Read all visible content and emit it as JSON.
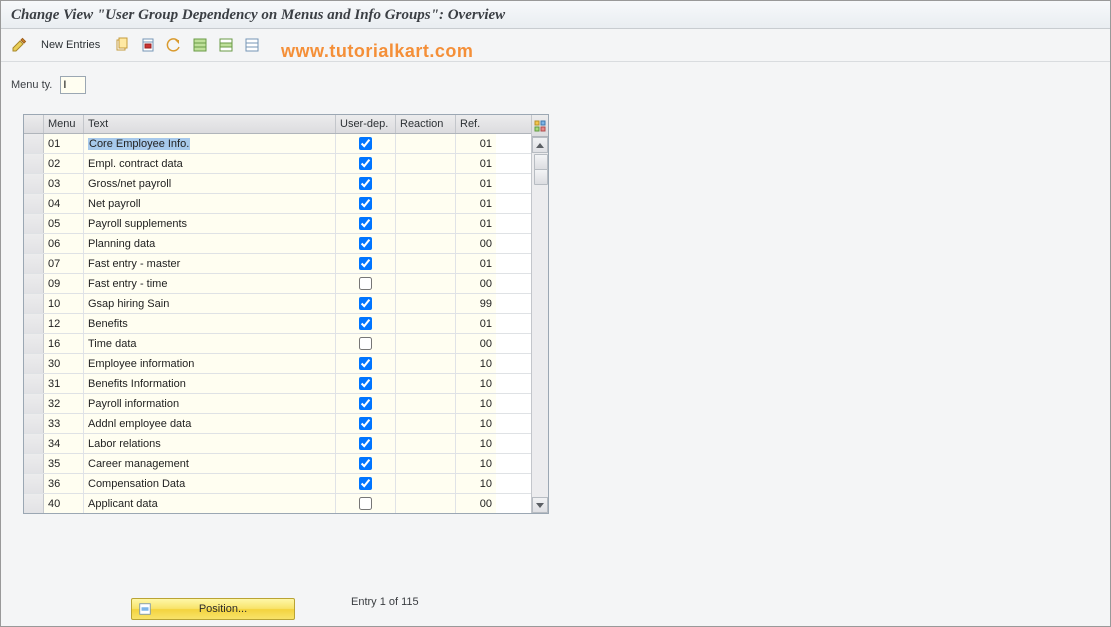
{
  "title": "Change View \"User Group Dependency on Menus and Info Groups\": Overview",
  "watermark": "www.tutorialkart.com",
  "toolbar": {
    "new_entries": "New Entries"
  },
  "field": {
    "label": "Menu ty.",
    "value": "I"
  },
  "columns": {
    "menu": "Menu",
    "text": "Text",
    "udep": "User-dep.",
    "reaction": "Reaction",
    "ref": "Ref."
  },
  "rows": [
    {
      "menu": "01",
      "text": "Core Employee Info.",
      "udep": true,
      "reaction": "",
      "ref": "01"
    },
    {
      "menu": "02",
      "text": "Empl. contract data",
      "udep": true,
      "reaction": "",
      "ref": "01"
    },
    {
      "menu": "03",
      "text": "Gross/net payroll",
      "udep": true,
      "reaction": "",
      "ref": "01"
    },
    {
      "menu": "04",
      "text": "Net payroll",
      "udep": true,
      "reaction": "",
      "ref": "01"
    },
    {
      "menu": "05",
      "text": "Payroll supplements",
      "udep": true,
      "reaction": "",
      "ref": "01"
    },
    {
      "menu": "06",
      "text": "Planning data",
      "udep": true,
      "reaction": "",
      "ref": "00"
    },
    {
      "menu": "07",
      "text": "Fast entry - master",
      "udep": true,
      "reaction": "",
      "ref": "01"
    },
    {
      "menu": "09",
      "text": "Fast entry - time",
      "udep": false,
      "reaction": "",
      "ref": "00"
    },
    {
      "menu": "10",
      "text": "Gsap hiring Sain",
      "udep": true,
      "reaction": "",
      "ref": "99"
    },
    {
      "menu": "12",
      "text": "Benefits",
      "udep": true,
      "reaction": "",
      "ref": "01"
    },
    {
      "menu": "16",
      "text": "Time data",
      "udep": false,
      "reaction": "",
      "ref": "00"
    },
    {
      "menu": "30",
      "text": "Employee information",
      "udep": true,
      "reaction": "",
      "ref": "10"
    },
    {
      "menu": "31",
      "text": "Benefits Information",
      "udep": true,
      "reaction": "",
      "ref": "10"
    },
    {
      "menu": "32",
      "text": "Payroll information",
      "udep": true,
      "reaction": "",
      "ref": "10"
    },
    {
      "menu": "33",
      "text": "Addnl employee data",
      "udep": true,
      "reaction": "",
      "ref": "10"
    },
    {
      "menu": "34",
      "text": "Labor relations",
      "udep": true,
      "reaction": "",
      "ref": "10"
    },
    {
      "menu": "35",
      "text": "Career management",
      "udep": true,
      "reaction": "",
      "ref": "10"
    },
    {
      "menu": "36",
      "text": "Compensation Data",
      "udep": true,
      "reaction": "",
      "ref": "10"
    },
    {
      "menu": "40",
      "text": "Applicant data",
      "udep": false,
      "reaction": "",
      "ref": "00"
    }
  ],
  "footer": {
    "position": "Position...",
    "entry": "Entry 1 of 115"
  }
}
